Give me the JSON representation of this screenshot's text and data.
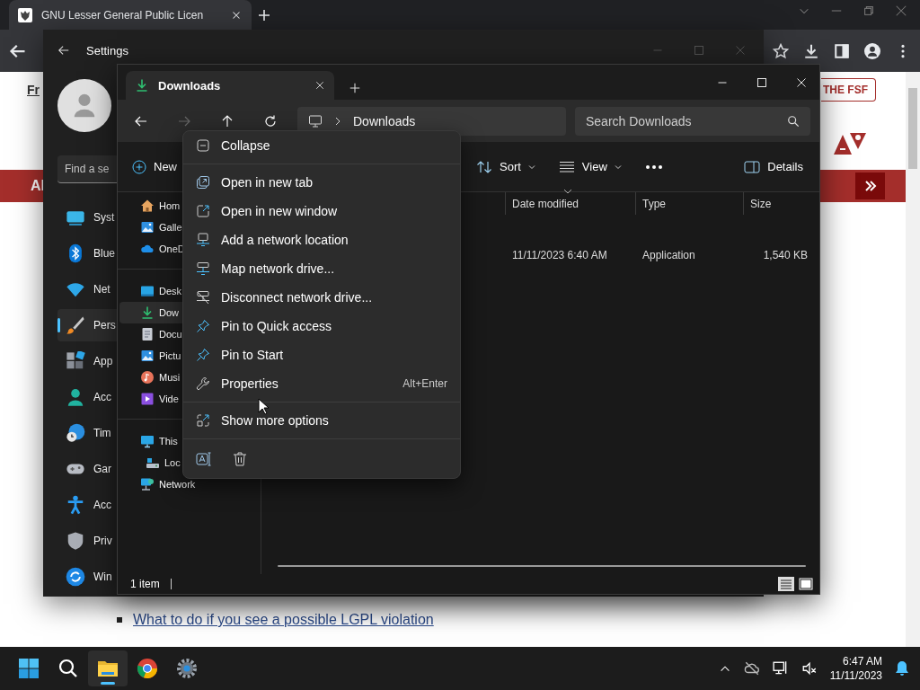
{
  "browser": {
    "tab_title": "GNU Lesser General Public Licen",
    "page": {
      "top_link": "Fr",
      "fsf_button": "THE FSF",
      "banner_text": "Al",
      "link": "What to do if you see a possible LGPL violation"
    }
  },
  "settings": {
    "title": "Settings",
    "search": {
      "placeholder": "Find a se"
    },
    "nav": [
      {
        "label": "Syst",
        "selected": false
      },
      {
        "label": "Blue",
        "selected": false
      },
      {
        "label": "Net",
        "selected": false
      },
      {
        "label": "Pers",
        "selected": true
      },
      {
        "label": "App",
        "selected": false
      },
      {
        "label": "Acc",
        "selected": false
      },
      {
        "label": "Tim",
        "selected": false
      },
      {
        "label": "Gar",
        "selected": false
      },
      {
        "label": "Acc",
        "selected": false
      },
      {
        "label": "Priv",
        "selected": false
      },
      {
        "label": "Win",
        "selected": false
      }
    ]
  },
  "explorer": {
    "tabs": [
      {
        "label": "Downloads",
        "selected": true
      }
    ],
    "breadcrumb": [
      "Downloads"
    ],
    "search": {
      "placeholder": "Search Downloads"
    },
    "toolbar": {
      "new": "New",
      "sort": "Sort",
      "view": "View",
      "details": "Details"
    },
    "columns": [
      "Date modified",
      "Type",
      "Size"
    ],
    "rows": [
      {
        "date": "11/11/2023 6:40 AM",
        "type": "Application",
        "size": "1,540 KB"
      }
    ],
    "nav_sections": [
      {
        "items": [
          {
            "label": "Hom",
            "selected": false
          },
          {
            "label": "Galle",
            "selected": false
          },
          {
            "label": "OneD",
            "selected": false
          }
        ]
      },
      {
        "items": [
          {
            "label": "Desk",
            "selected": false
          },
          {
            "label": "Dow",
            "selected": true
          },
          {
            "label": "Docu",
            "selected": false
          },
          {
            "label": "Pictu",
            "selected": false
          },
          {
            "label": "Musi",
            "selected": false
          },
          {
            "label": "Vide",
            "selected": false
          }
        ]
      },
      {
        "items": [
          {
            "label": "This",
            "selected": false,
            "children": [
              {
                "label": "Loc",
                "selected": false
              }
            ]
          },
          {
            "label": "Network",
            "selected": false
          }
        ]
      }
    ],
    "status": "1 item"
  },
  "context_menu": {
    "groups": [
      {
        "items": [
          {
            "label": "Collapse"
          }
        ]
      },
      {
        "items": [
          {
            "label": "Open in new tab"
          },
          {
            "label": "Open in new window"
          },
          {
            "label": "Add a network location"
          },
          {
            "label": "Map network drive..."
          },
          {
            "label": "Disconnect network drive..."
          },
          {
            "label": "Pin to Quick access"
          },
          {
            "label": "Pin to Start"
          },
          {
            "label": "Properties",
            "shortcut": "Alt+Enter"
          }
        ]
      },
      {
        "items": [
          {
            "label": "Show more options"
          }
        ]
      }
    ]
  },
  "taskbar": {
    "apps": [
      {
        "selected": false
      },
      {
        "selected": false
      },
      {
        "selected": true
      },
      {
        "selected": false
      },
      {
        "selected": false
      }
    ],
    "time": "6:47 AM",
    "date": "11/11/2023"
  }
}
